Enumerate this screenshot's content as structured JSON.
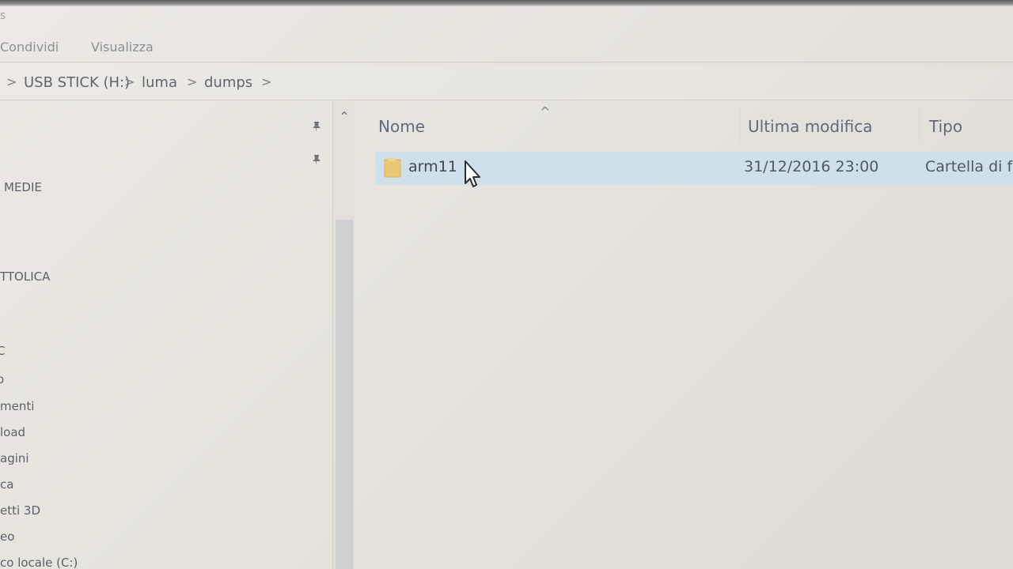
{
  "window": {
    "title_fragment": "s"
  },
  "ribbon": {
    "tabs": [
      "Condividi",
      "Visualizza"
    ]
  },
  "breadcrumb": {
    "items": [
      "USB STICK (H:)",
      "luma",
      "dumps"
    ],
    "separator": ">"
  },
  "nav": {
    "items": [
      "MEDIE",
      "TTOLICA",
      "C",
      "o",
      "menti",
      "load",
      "agini",
      "ca",
      "etti 3D",
      "eo",
      "co locale (C:)"
    ]
  },
  "files": {
    "sort_indicator": "^",
    "columns": {
      "name": "Nome",
      "modified": "Ultima modifica",
      "type": "Tipo"
    },
    "rows": [
      {
        "name": "arm11",
        "modified": "31/12/2016 23:00",
        "type": "Cartella di f"
      }
    ]
  },
  "colors": {
    "selection": "#cfe0ea",
    "folder": "#e9c874",
    "header_text": "#5c6c80"
  },
  "icons": [
    "pin-icon",
    "folder-icon",
    "mouse-cursor-icon",
    "scroll-up-icon"
  ]
}
